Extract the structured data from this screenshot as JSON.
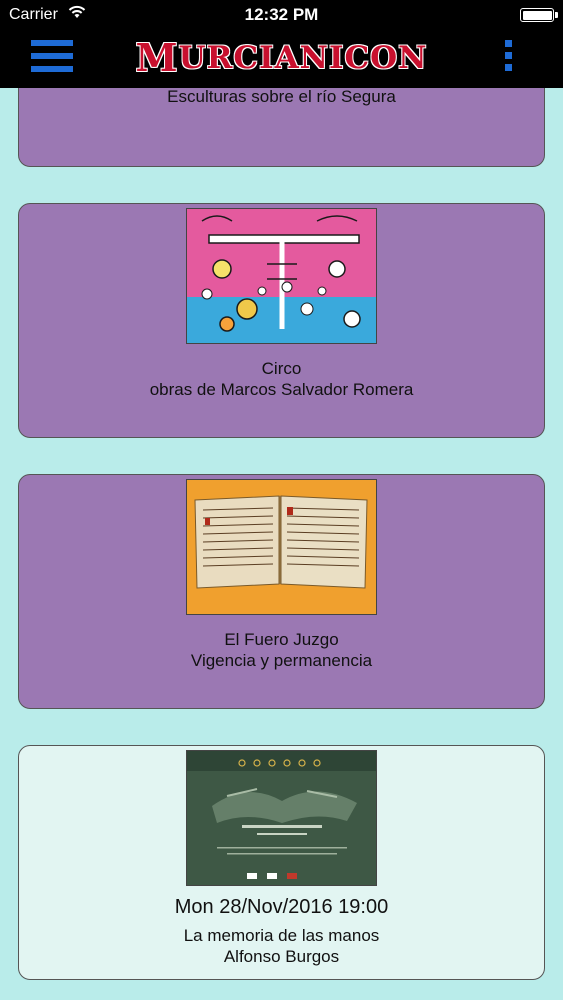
{
  "status_bar": {
    "carrier": "Carrier",
    "time": "12:32 PM"
  },
  "nav": {
    "brand_first": "M",
    "brand_rest": "URCIANICON"
  },
  "cards": [
    {
      "title": "Esculturas sobre el río Segura",
      "subtitle": ""
    },
    {
      "title": "Circo",
      "subtitle": "obras de Marcos Salvador Romera",
      "image": "circus-artwork-thumbnail"
    },
    {
      "title": "El Fuero Juzgo",
      "subtitle": "Vigencia y permanencia",
      "image": "old-book-thumbnail"
    },
    {
      "date": "Mon 28/Nov/2016 19:00",
      "title": "La memoria de las manos",
      "subtitle": "Alfonso Burgos",
      "image": "exhibition-poster-thumbnail"
    }
  ],
  "colors": {
    "background": "#b9ecea",
    "card_purple": "#9b78b3",
    "card_light": "#e2f5f2",
    "accent_blue": "#1e6bd6",
    "brand_red": "#c8102e"
  }
}
